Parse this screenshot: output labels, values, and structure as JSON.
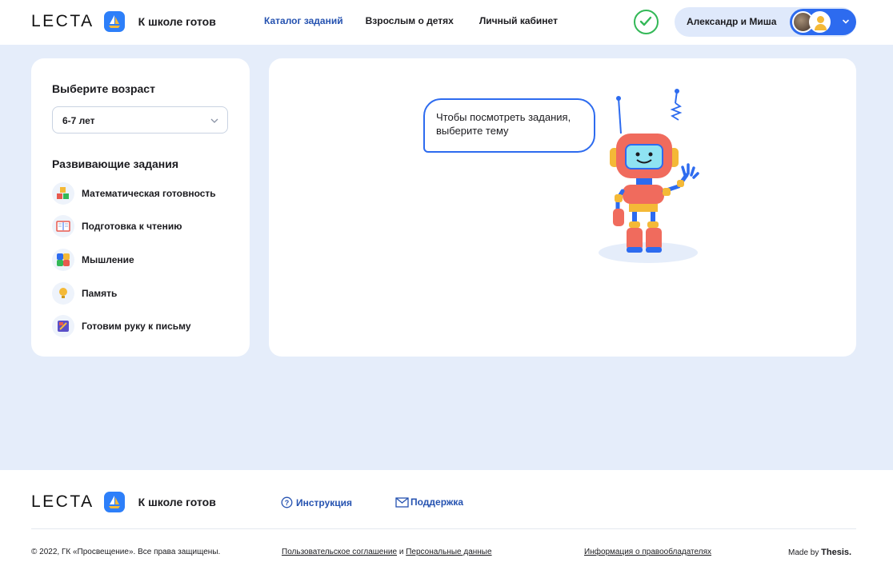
{
  "brand": {
    "word": "LECTA",
    "title": "К школе готов"
  },
  "nav": {
    "catalog": "Каталог заданий",
    "adults": "Взрослым о детях",
    "cabinet": "Личный кабинет"
  },
  "user": {
    "name": "Александр и Миша"
  },
  "sidebar": {
    "age_heading": "Выберите возраст",
    "age_value": "6-7 лет",
    "topics_heading": "Развивающие задания",
    "topics": [
      {
        "label": "Математическая готовность",
        "icon": "blocks-icon"
      },
      {
        "label": "Подготовка к чтению",
        "icon": "book-icon"
      },
      {
        "label": "Мышление",
        "icon": "puzzle-icon"
      },
      {
        "label": "Память",
        "icon": "lightbulb-icon"
      },
      {
        "label": "Готовим руку к письму",
        "icon": "notebook-icon"
      }
    ]
  },
  "content": {
    "bubble": "Чтобы посмотреть задания, выберите тему"
  },
  "footer": {
    "instruction": "Инструкция",
    "support": "Поддержка",
    "copyright": "© 2022, ГК «Просвещение». Все права защищены.",
    "agreement": "Пользовательское соглашение",
    "and": " и ",
    "personal": "Персональные данные",
    "rights": "Информация о правообладателях",
    "made_by": "Made by",
    "made_by_brand": "Thesis."
  },
  "colors": {
    "accent": "#2d6bef",
    "page_bg": "#e5edfa",
    "nav_active": "#2552b0",
    "check": "#33b857"
  }
}
